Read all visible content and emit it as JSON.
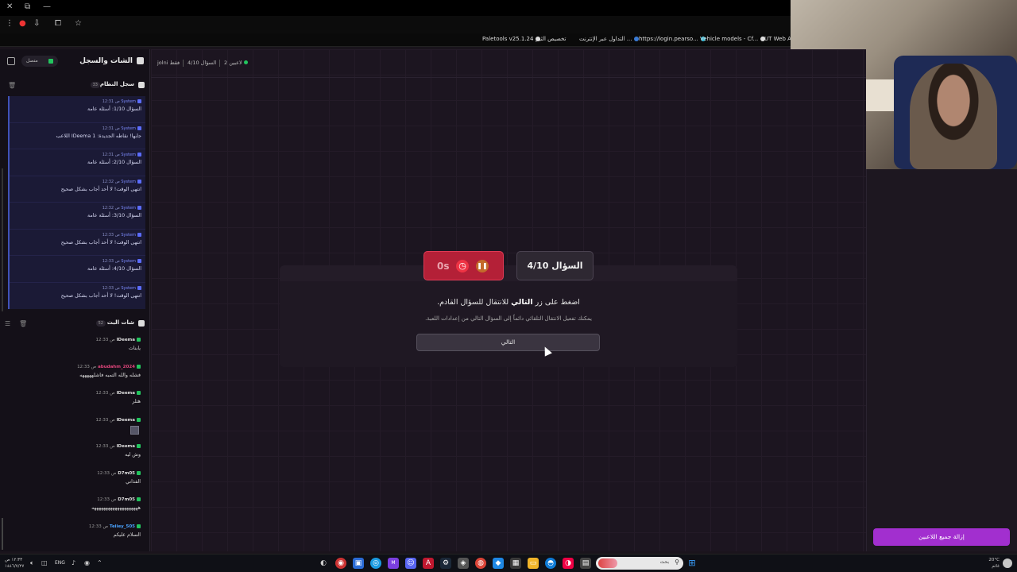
{
  "browser": {
    "bookmarks": [
      {
        "label": "Paletools v25.1.24"
      },
      {
        "label": "تخصيص الثيم"
      },
      {
        "label": "التداول عبر الإنترنت ..."
      },
      {
        "label": "https://login.pearso..."
      },
      {
        "label": "Vehicle models - Cf..."
      },
      {
        "label": "FUT Web App"
      }
    ]
  },
  "sidebar": {
    "title": "الشات والسجل",
    "status": "متصل",
    "system_log": {
      "title": "سجل النظام",
      "count": "33",
      "items": [
        {
          "sender": "System",
          "time": "12:31 ص",
          "text": "السؤال 1/10: أسئلة عامة"
        },
        {
          "sender": "System",
          "time": "12:31 ص",
          "text": "اللاعب IDeema جابها! نقاطه الجديدة: 1"
        },
        {
          "sender": "System",
          "time": "12:31 ص",
          "text": "السؤال 2/10: أسئلة عامة"
        },
        {
          "sender": "System",
          "time": "12:32 ص",
          "text": "انتهى الوقت! لا أحد أجاب بشكل صحيح"
        },
        {
          "sender": "System",
          "time": "12:32 ص",
          "text": "السؤال 3/10: أسئلة عامة"
        },
        {
          "sender": "System",
          "time": "12:33 ص",
          "text": "انتهى الوقت! لا أحد أجاب بشكل صحيح"
        },
        {
          "sender": "System",
          "time": "12:33 ص",
          "text": "السؤال 4/10: أسئلة عامة"
        },
        {
          "sender": "System",
          "time": "12:33 ص",
          "text": "انتهى الوقت! لا أحد أجاب بشكل صحيح"
        }
      ]
    },
    "live_chat": {
      "title": "شات البث",
      "count": "52",
      "items": [
        {
          "name": "IDeema",
          "time": "12:33 ص",
          "text": "يابنات",
          "name_color": "#dddddd"
        },
        {
          "name": "abudahm_2024",
          "time": "12:33 ص",
          "text": "فشله والله التمبه فاشلهههههه",
          "name_color": "#e0457b"
        },
        {
          "name": "IDeema",
          "time": "12:33 ص",
          "text": "هتلر",
          "name_color": "#dddddd"
        },
        {
          "name": "IDeema",
          "time": "12:33 ص",
          "text": "",
          "name_color": "#dddddd",
          "image": true
        },
        {
          "name": "IDeema",
          "time": "12:33 ص",
          "text": "وش ليه",
          "name_color": "#dddddd"
        },
        {
          "name": "D7m05",
          "time": "12:33 ص",
          "text": "الفذاني",
          "name_color": "#dddddd"
        },
        {
          "name": "D7m05",
          "time": "12:33 ص",
          "text": "ههههههههههههههههههههه",
          "name_color": "#dddddd"
        },
        {
          "name": "Teiiey_505",
          "time": "12:33 ص",
          "text": "السلام عليكم",
          "name_color": "#4aa3ff"
        }
      ]
    }
  },
  "main": {
    "players": "2 لاعبين",
    "progress": "السؤال 4/10",
    "mode": "jolni فقط",
    "timer": "0s",
    "question_badge": "السؤال 4/10",
    "prompt_before": "اضغط على زر ",
    "prompt_bold": "التالي",
    "prompt_after": " للانتقال للسؤال القادم.",
    "hint": "يمكنك تفعيل الانتقال التلقائي دائماً إلى السؤال التالي من إعدادات اللعبة.",
    "next_button": "التالي",
    "remove_all_button": "إزالة جميع اللاعبين"
  },
  "taskbar": {
    "time": "١٢:٣٣ ص",
    "date": "١٤٤٦/٧/٢٧",
    "lang": "ENG",
    "search_placeholder": "بحث",
    "weather_temp": "20°C",
    "weather_desc": "غائم"
  },
  "colors": {
    "accent_purple": "#a22fcf",
    "timer_red": "#b42037",
    "system_blue": "#4052b8",
    "online_green": "#22c55e"
  }
}
